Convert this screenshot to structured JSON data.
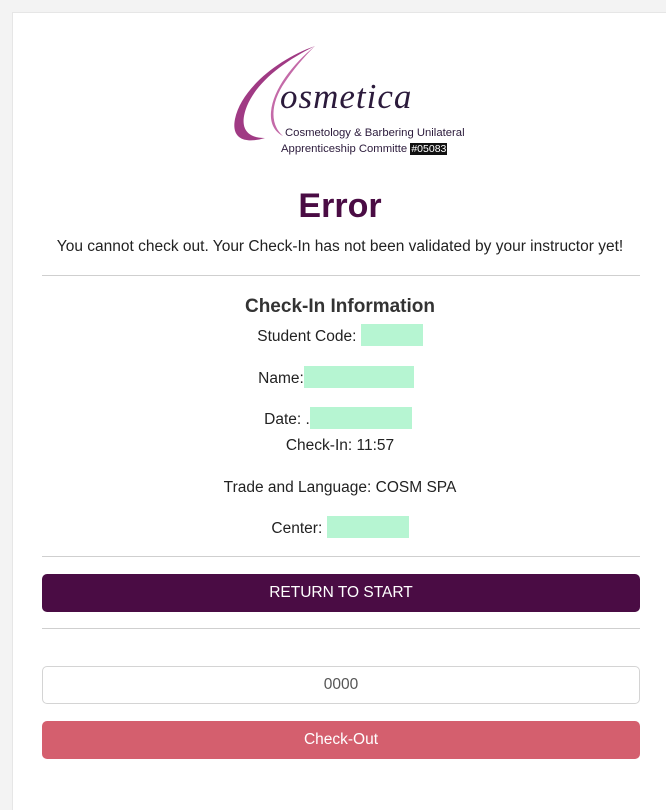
{
  "logo": {
    "word": "osmetica",
    "subtitle_line1": "Cosmetology & Barbering Unilateral",
    "subtitle_line2": "Apprenticeship Committe ",
    "badge": "#05083",
    "swoosh_color": "#a03a84"
  },
  "error": {
    "title": "Error",
    "message": "You cannot check out. Your Check-In has not been validated by your instructor yet!"
  },
  "checkin_info": {
    "title": "Check-In Information",
    "student_code_label": "Student Code: ",
    "name_label": "Name:",
    "date_label": "Date: .",
    "checkin_time": "Check-In: 11:57",
    "trade_language": "Trade and Language: COSM SPA",
    "center_label": "Center: "
  },
  "actions": {
    "return_label": "RETURN TO START",
    "pin_placeholder": "0000",
    "checkout_label": "Check-Out"
  },
  "colors": {
    "primary": "#4a0c44",
    "checkout": "#d45f6e",
    "redaction": "#b6f5d2"
  }
}
